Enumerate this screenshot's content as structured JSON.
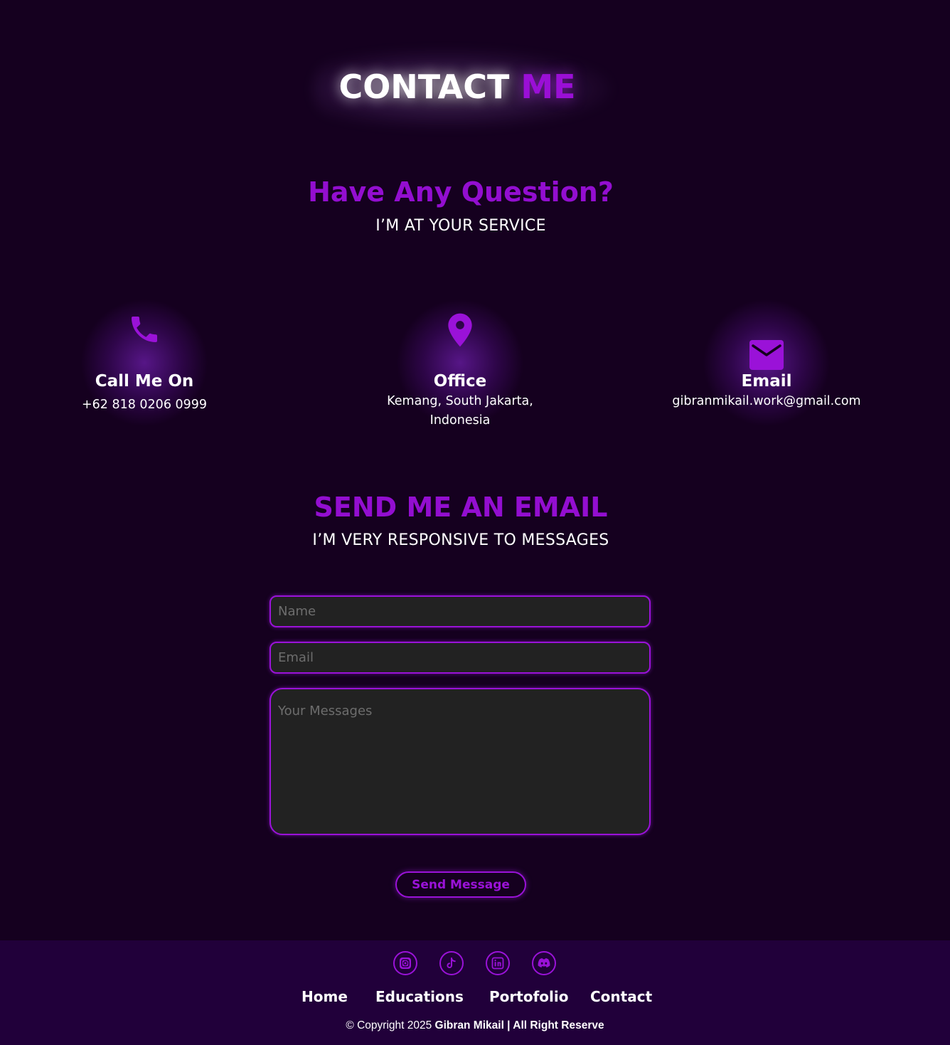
{
  "header": {
    "title_main": "CONTACT",
    "title_accent": "ME"
  },
  "intro": {
    "headline": "Have Any Question?",
    "subheadline": "I’M AT YOUR SERVICE"
  },
  "contact_cards": [
    {
      "icon": "phone-icon",
      "label": "Call Me On",
      "value": "+62 818 0206 0999"
    },
    {
      "icon": "location-pin-icon",
      "label": "Office",
      "value_line1": "Kemang, South Jakarta,",
      "value_line2": "Indonesia"
    },
    {
      "icon": "envelope-icon",
      "label": "Email",
      "value": "gibranmikail.work@gmail.com"
    }
  ],
  "email_section": {
    "headline": "SEND ME AN EMAIL",
    "subheadline": "I’M VERY RESPONSIVE TO MESSAGES"
  },
  "form": {
    "name_placeholder": "Name",
    "name_value": "",
    "email_placeholder": "Email",
    "email_value": "",
    "message_placeholder": "Your Messages",
    "message_value": "",
    "submit_label": "Send Message"
  },
  "footer": {
    "social_icons": [
      "instagram-icon",
      "tiktok-icon",
      "linkedin-icon",
      "discord-icon"
    ],
    "nav": [
      "Home",
      "Educations",
      "Portofolio",
      "Contact"
    ],
    "copyright_prefix": "© Copyright 2025",
    "copyright_owner": "Gibran Mikail | All Right Reserve"
  },
  "colors": {
    "background": "#15001f",
    "accent": "#9a12d8",
    "footer_background": "#21003a",
    "field_background": "#222222"
  }
}
